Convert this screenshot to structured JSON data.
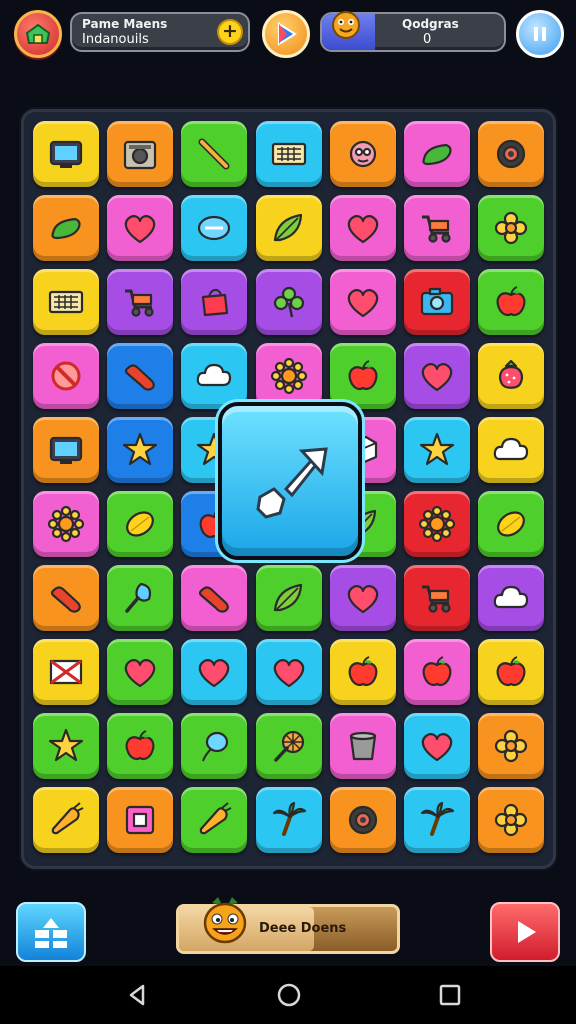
{
  "hud": {
    "left_title": "Pame Maens",
    "left_value": "Indanouils",
    "plus_label": "+",
    "right_title": "Qodgras",
    "right_value": "0",
    "right_bar_fraction": 0.29
  },
  "board": {
    "rows": [
      [
        {
          "c": "yellow",
          "i": "tv"
        },
        {
          "c": "orange",
          "i": "radio"
        },
        {
          "c": "green",
          "i": "stick"
        },
        {
          "c": "cyan",
          "i": "keyboard"
        },
        {
          "c": "orange",
          "i": "mask"
        },
        {
          "c": "pink",
          "i": "pickle"
        },
        {
          "c": "orange",
          "i": "ring"
        }
      ],
      [
        {
          "c": "orange",
          "i": "pickle"
        },
        {
          "c": "pink",
          "i": "heart"
        },
        {
          "c": "cyan",
          "i": "badge"
        },
        {
          "c": "yellow",
          "i": "leaf"
        },
        {
          "c": "pink",
          "i": "heart"
        },
        {
          "c": "pink",
          "i": "cart"
        },
        {
          "c": "green",
          "i": "flower"
        }
      ],
      [
        {
          "c": "yellow",
          "i": "keyboard"
        },
        {
          "c": "purple",
          "i": "cart"
        },
        {
          "c": "purple",
          "i": "bag"
        },
        {
          "c": "purple",
          "i": "clover"
        },
        {
          "c": "pink",
          "i": "heart"
        },
        {
          "c": "red",
          "i": "camera"
        },
        {
          "c": "green",
          "i": "apple"
        }
      ],
      [
        {
          "c": "pink",
          "i": "ban"
        },
        {
          "c": "blue",
          "i": "sausage"
        },
        {
          "c": "cyan",
          "i": "cloud"
        },
        {
          "c": "pink",
          "i": "sun"
        },
        {
          "c": "green",
          "i": "apple"
        },
        {
          "c": "purple",
          "i": "heart"
        },
        {
          "c": "yellow",
          "i": "berry"
        }
      ],
      [
        {
          "c": "orange",
          "i": "tv"
        },
        {
          "c": "blue",
          "i": "star"
        },
        {
          "c": "cyan",
          "i": "star"
        },
        {
          "c": "cyan",
          "i": "blank"
        },
        {
          "c": "pink",
          "i": "cube"
        },
        {
          "c": "cyan",
          "i": "star"
        },
        {
          "c": "yellow",
          "i": "cloud"
        }
      ],
      [
        {
          "c": "pink",
          "i": "sun"
        },
        {
          "c": "green",
          "i": "lemon"
        },
        {
          "c": "blue",
          "i": "apple"
        },
        {
          "c": "cyan",
          "i": "blank"
        },
        {
          "c": "green",
          "i": "leaf"
        },
        {
          "c": "red",
          "i": "sun"
        },
        {
          "c": "green",
          "i": "lemon"
        }
      ],
      [
        {
          "c": "orange",
          "i": "sausage"
        },
        {
          "c": "green",
          "i": "trowel"
        },
        {
          "c": "pink",
          "i": "sausage"
        },
        {
          "c": "green",
          "i": "leaf"
        },
        {
          "c": "purple",
          "i": "heart"
        },
        {
          "c": "red",
          "i": "cart"
        },
        {
          "c": "purple",
          "i": "cloud"
        }
      ],
      [
        {
          "c": "yellow",
          "i": "envelope"
        },
        {
          "c": "green",
          "i": "heart"
        },
        {
          "c": "cyan",
          "i": "heart"
        },
        {
          "c": "cyan",
          "i": "heart"
        },
        {
          "c": "yellow",
          "i": "apple"
        },
        {
          "c": "pink",
          "i": "apple"
        },
        {
          "c": "yellow",
          "i": "apple"
        }
      ],
      [
        {
          "c": "green",
          "i": "star"
        },
        {
          "c": "green",
          "i": "apple"
        },
        {
          "c": "green",
          "i": "balloon"
        },
        {
          "c": "green",
          "i": "fan"
        },
        {
          "c": "pink",
          "i": "bucket"
        },
        {
          "c": "cyan",
          "i": "heart"
        },
        {
          "c": "orange",
          "i": "flower"
        }
      ],
      [
        {
          "c": "yellow",
          "i": "carrot"
        },
        {
          "c": "orange",
          "i": "frame"
        },
        {
          "c": "green",
          "i": "carrot"
        },
        {
          "c": "cyan",
          "i": "palm"
        },
        {
          "c": "orange",
          "i": "ring"
        },
        {
          "c": "cyan",
          "i": "palm"
        },
        {
          "c": "orange",
          "i": "flower"
        }
      ]
    ],
    "palette": {
      "yellow": "#f7d31e",
      "orange": "#f7931e",
      "green": "#4fcf2b",
      "cyan": "#2cc6f2",
      "pink": "#f25fd0",
      "purple": "#a64de6",
      "red": "#e8262f",
      "blue": "#1f7fe8"
    },
    "selected_icon": "arrow-cursor-icon"
  },
  "bottom": {
    "progress_label": "Deee Doens",
    "progress_fraction": 0.62
  }
}
